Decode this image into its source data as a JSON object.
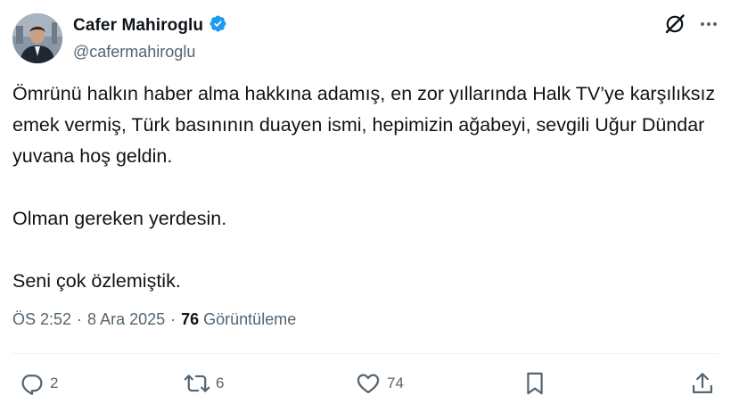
{
  "author": {
    "display_name": "Cafer Mahiroglu",
    "handle": "@cafermahiroglu",
    "verified_color": "#1d9bf0"
  },
  "tweet": {
    "text": "Ömrünü halkın haber alma hakkına adamış, en zor yıllarında Halk TV’ye karşılıksız emek vermiş, Türk basınının duayen ismi, hepimizin ağabeyi, sevgili Uğur Dündar yuvana hoş geldin.\n\nOlman gereken yerdesin.\n\nSeni çok özlemiştik."
  },
  "meta": {
    "time": "ÖS 2:52",
    "separator": "·",
    "date": "8 Ara 2025",
    "views_count": "76",
    "views_label": "Görüntüleme"
  },
  "actions": {
    "replies": "2",
    "reposts": "6",
    "likes": "74"
  },
  "icons": {
    "grok": "grok-icon",
    "more": "more-icon",
    "reply": "reply-icon",
    "repost": "repost-icon",
    "like": "heart-icon",
    "bookmark": "bookmark-icon",
    "share": "share-icon",
    "verified": "verified-badge-icon"
  },
  "colors": {
    "text": "#0f1419",
    "secondary": "#536471",
    "divider": "#eff3f4"
  }
}
